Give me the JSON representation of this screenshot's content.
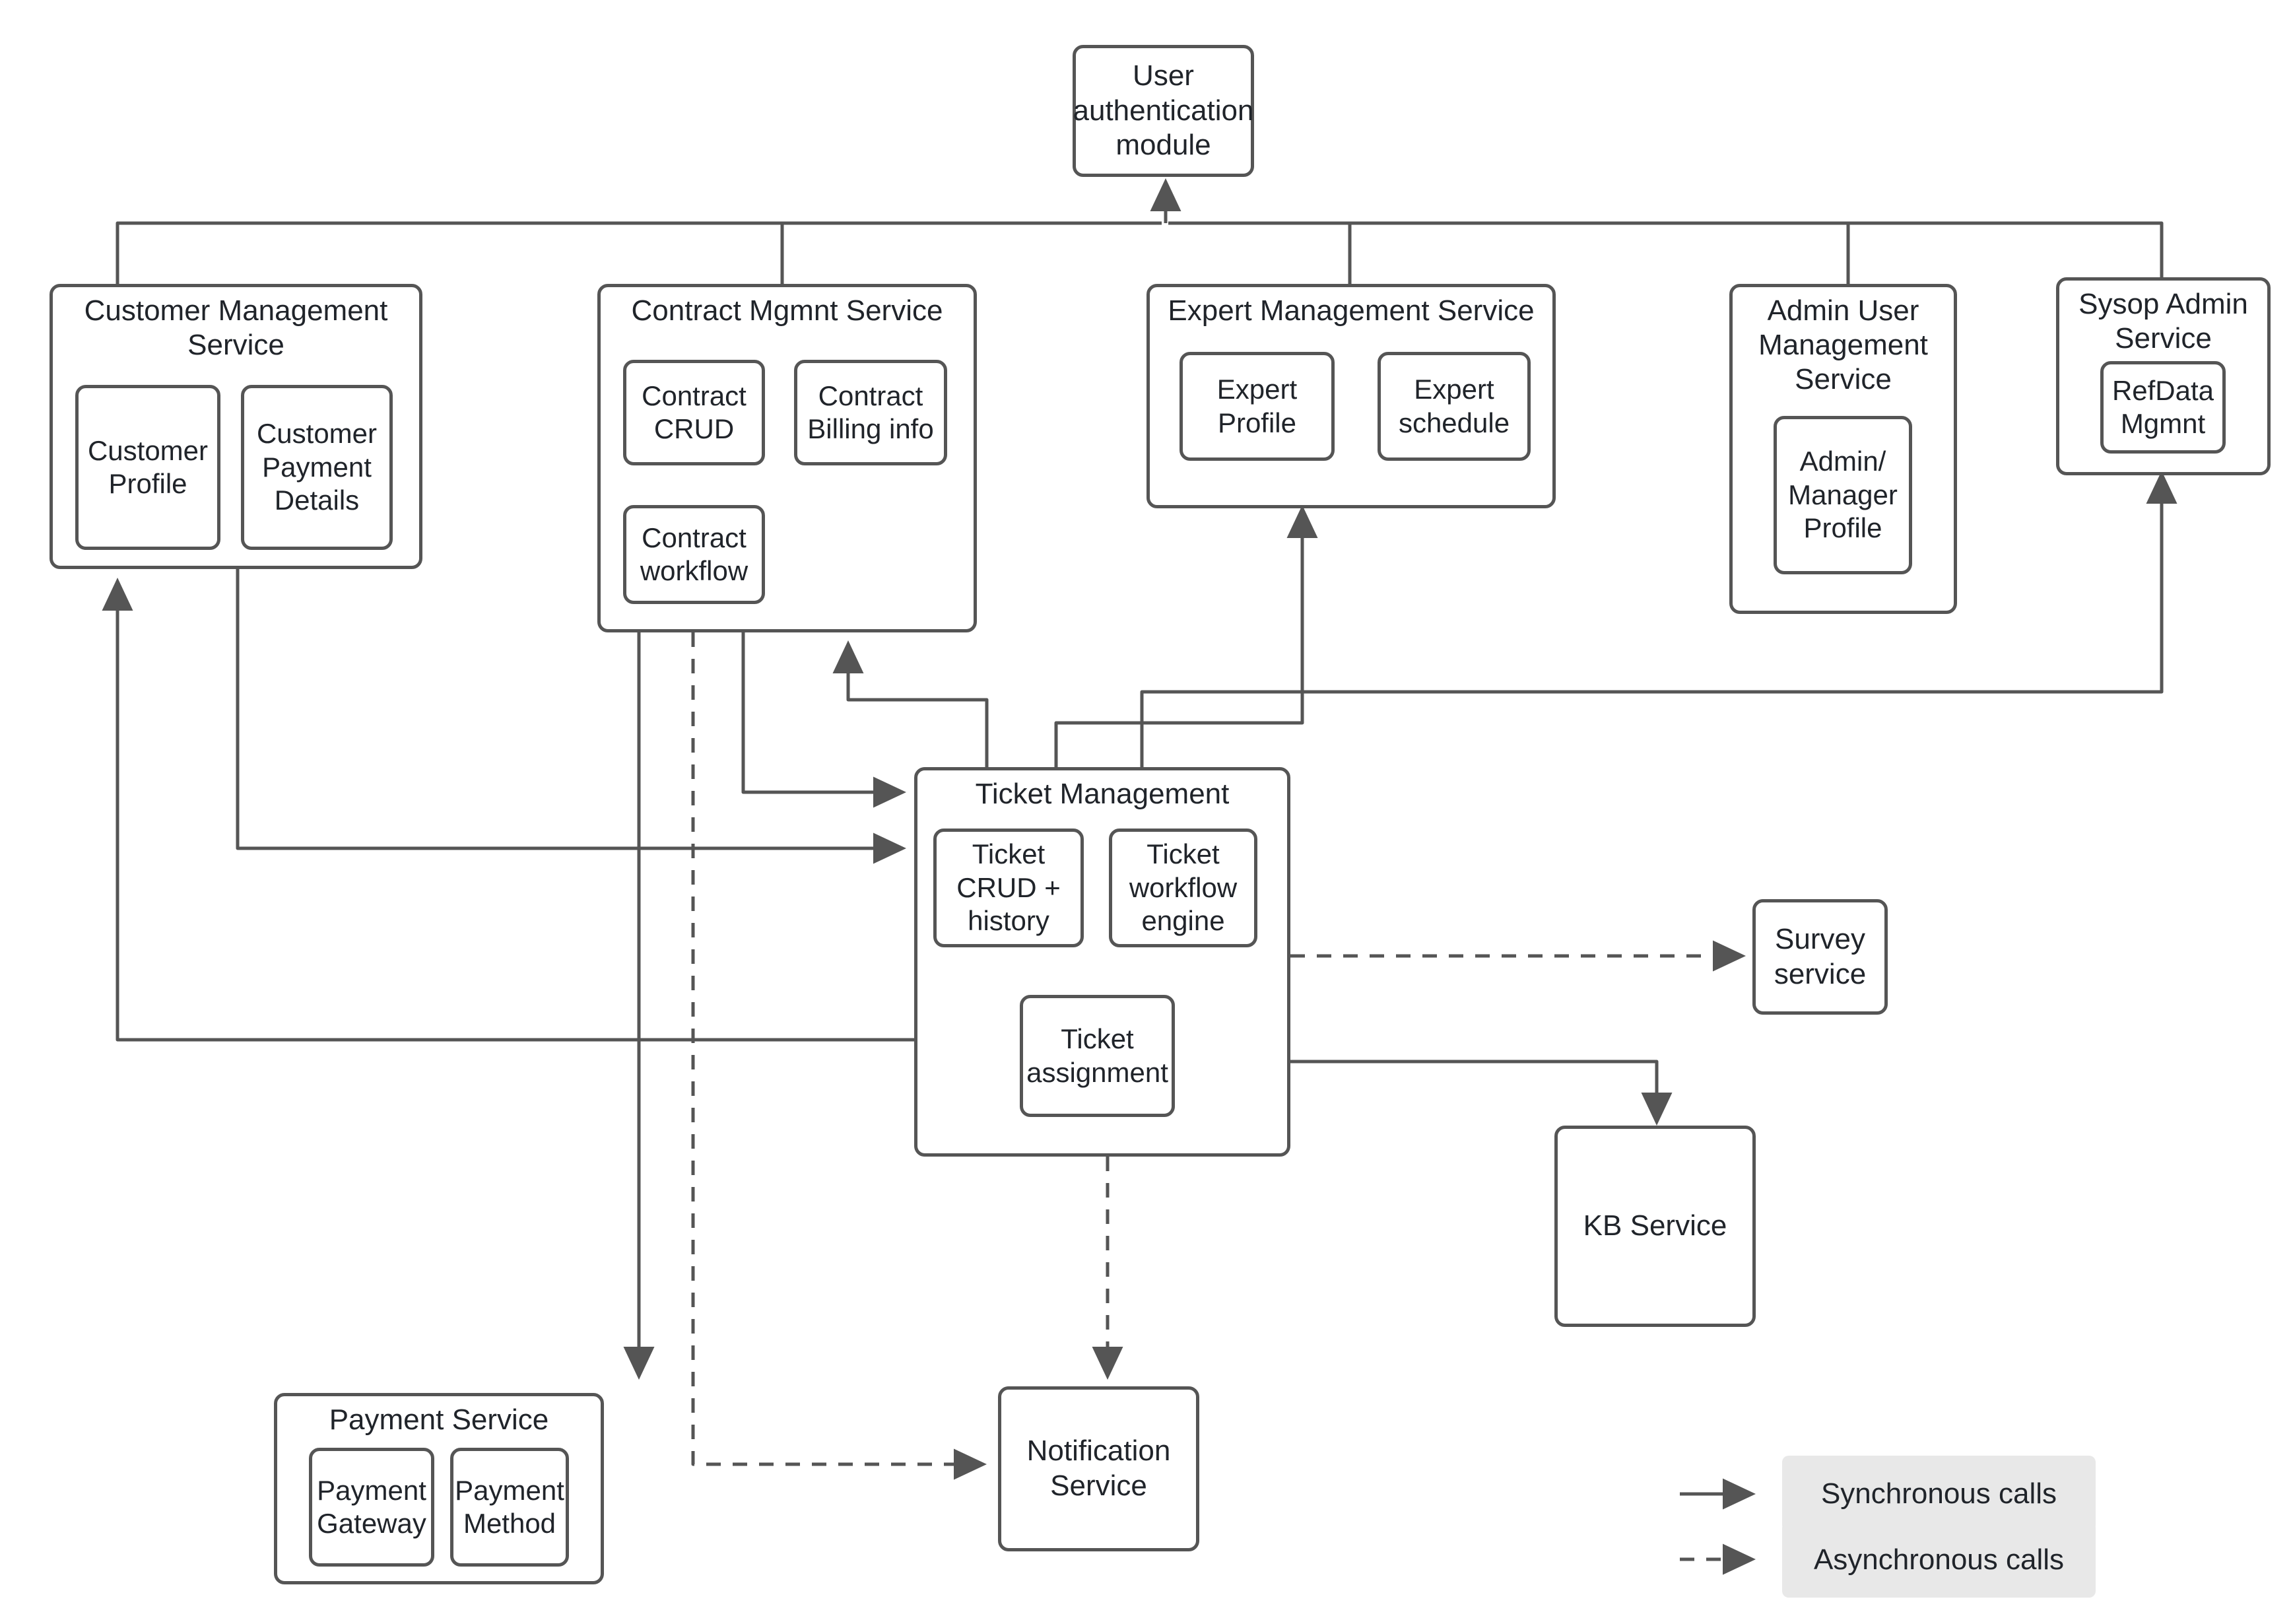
{
  "diagram": {
    "title": "Service architecture diagram",
    "line_color": "#555555",
    "text_color": "#20242a",
    "legend_chip_color": "#e8e8e8"
  },
  "nodes": {
    "auth": {
      "label": "User\nauthentication\nmodule"
    },
    "customer_mgmt": {
      "title": "Customer  Management\nService",
      "children": [
        {
          "label": "Customer\nProfile"
        },
        {
          "label": "Customer\nPayment\nDetails"
        }
      ]
    },
    "contract_mgmt": {
      "title": "Contract Mgmnt Service",
      "children": [
        {
          "label": "Contract\nCRUD"
        },
        {
          "label": "Contract\nBilling info"
        },
        {
          "label": "Contract\nworkflow"
        }
      ]
    },
    "expert_mgmt": {
      "title": "Expert Management Service",
      "children": [
        {
          "label": "Expert\nProfile"
        },
        {
          "label": "Expert\nschedule"
        }
      ]
    },
    "admin_user_mgmt": {
      "title": "Admin User\nManagement\nService",
      "children": [
        {
          "label": "Admin/\nManager\nProfile"
        }
      ]
    },
    "sysop_admin": {
      "title": "Sysop Admin\nService",
      "children": [
        {
          "label": "RefData\nMgmnt"
        }
      ]
    },
    "ticket_mgmt": {
      "title": "Ticket Management",
      "children": [
        {
          "label": "Ticket\nCRUD +\nhistory"
        },
        {
          "label": "Ticket\nworkflow\nengine"
        },
        {
          "label": "Ticket\nassignment"
        }
      ]
    },
    "survey": {
      "label": "Survey\nservice"
    },
    "kb": {
      "label": "KB Service"
    },
    "payment": {
      "title": "Payment Service",
      "children": [
        {
          "label": "Payment\nGateway"
        },
        {
          "label": "Payment\nMethod"
        }
      ]
    },
    "notification": {
      "label": "Notification\nService"
    }
  },
  "legend": {
    "items": [
      {
        "style": "solid",
        "label": "Synchronous calls"
      },
      {
        "style": "dashed",
        "label": "Asynchronous calls"
      }
    ]
  }
}
